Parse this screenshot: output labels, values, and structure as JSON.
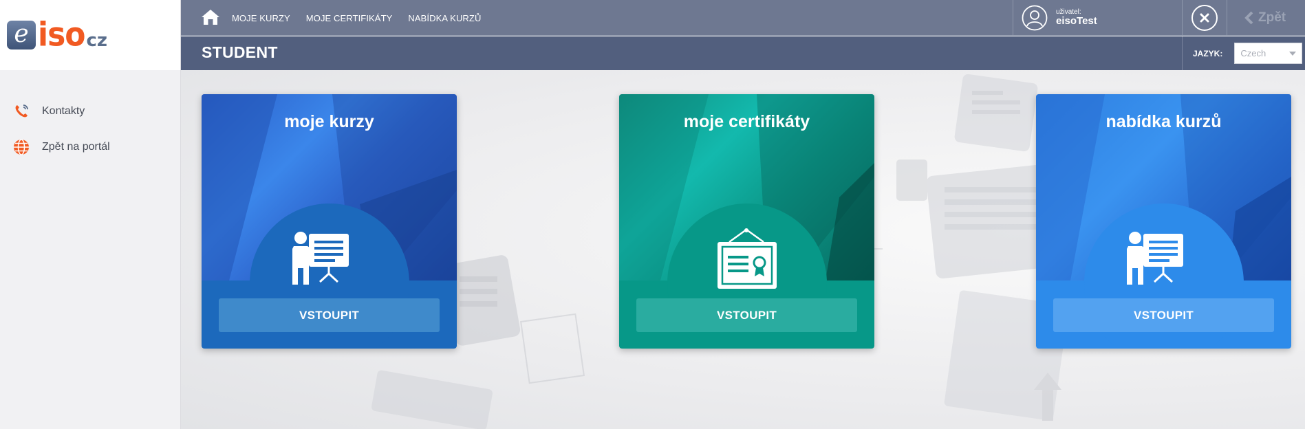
{
  "brand": {
    "logo_e": "e",
    "logo_iso": "iso",
    "logo_cz": "cz"
  },
  "sidebar": {
    "items": [
      {
        "label": "Kontakty",
        "icon": "phone-icon"
      },
      {
        "label": "Zpět na portál",
        "icon": "globe-icon"
      }
    ]
  },
  "topbar": {
    "home_icon": "home-icon",
    "nav": [
      "MOJE KURZY",
      "MOJE CERTIFIKÁTY",
      "NABÍDKA KURZŮ"
    ],
    "user_caption": "uživatel:",
    "user_name": "eisoTest",
    "close_icon": "close-icon",
    "back_label": "Zpět"
  },
  "section": {
    "title": "STUDENT",
    "language_label": "JAZYK:",
    "language_value": "Czech"
  },
  "cards": [
    {
      "title": "moje kurzy",
      "button": "VSTOUPIT",
      "icon": "presentation-icon"
    },
    {
      "title": "moje certifikáty",
      "button": "VSTOUPIT",
      "icon": "certificate-icon"
    },
    {
      "title": "nabídka kurzů",
      "button": "VSTOUPIT",
      "icon": "presentation-icon"
    }
  ],
  "colors": {
    "accent_orange": "#f15a22",
    "topbar": "#6e7891",
    "section_bar": "#525f7e",
    "card_blue": "#1c69bc",
    "card_teal": "#079888",
    "card_light_blue": "#2d8bea"
  }
}
